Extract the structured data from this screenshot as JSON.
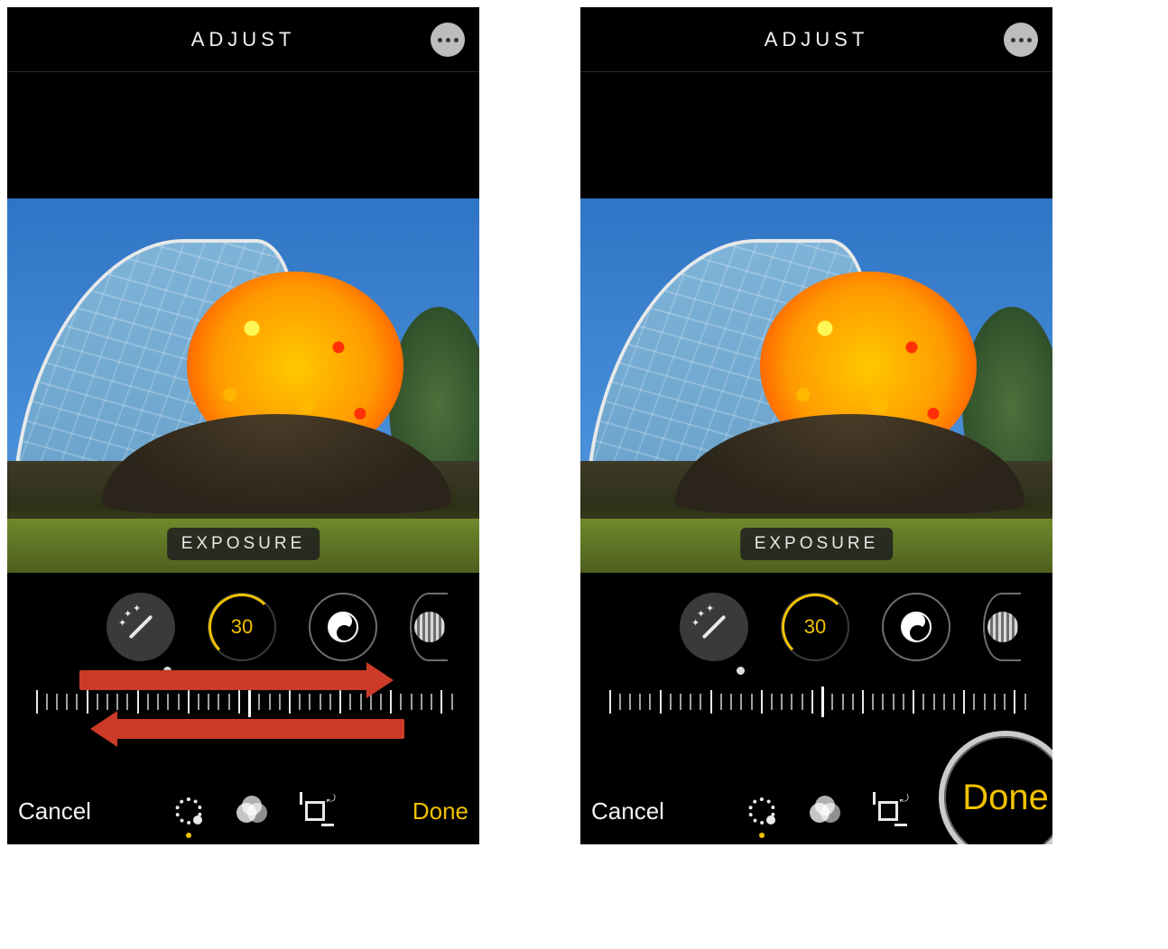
{
  "screens": [
    {
      "header": {
        "title": "ADJUST"
      },
      "adjustment": {
        "label": "EXPOSURE",
        "value": "30"
      },
      "footer": {
        "cancel": "Cancel",
        "done": "Done"
      },
      "annotations": {
        "swipe_arrows": true
      },
      "ruler_dot_offset_pct": 33,
      "done_highlight": false
    },
    {
      "header": {
        "title": "ADJUST"
      },
      "adjustment": {
        "label": "EXPOSURE",
        "value": "30"
      },
      "footer": {
        "cancel": "Cancel",
        "done": "Done"
      },
      "annotations": {
        "swipe_arrows": false
      },
      "ruler_dot_offset_pct": 33,
      "done_highlight": true
    }
  ],
  "colors": {
    "accent": "#f2c200",
    "arrow": "#cc3b27"
  }
}
